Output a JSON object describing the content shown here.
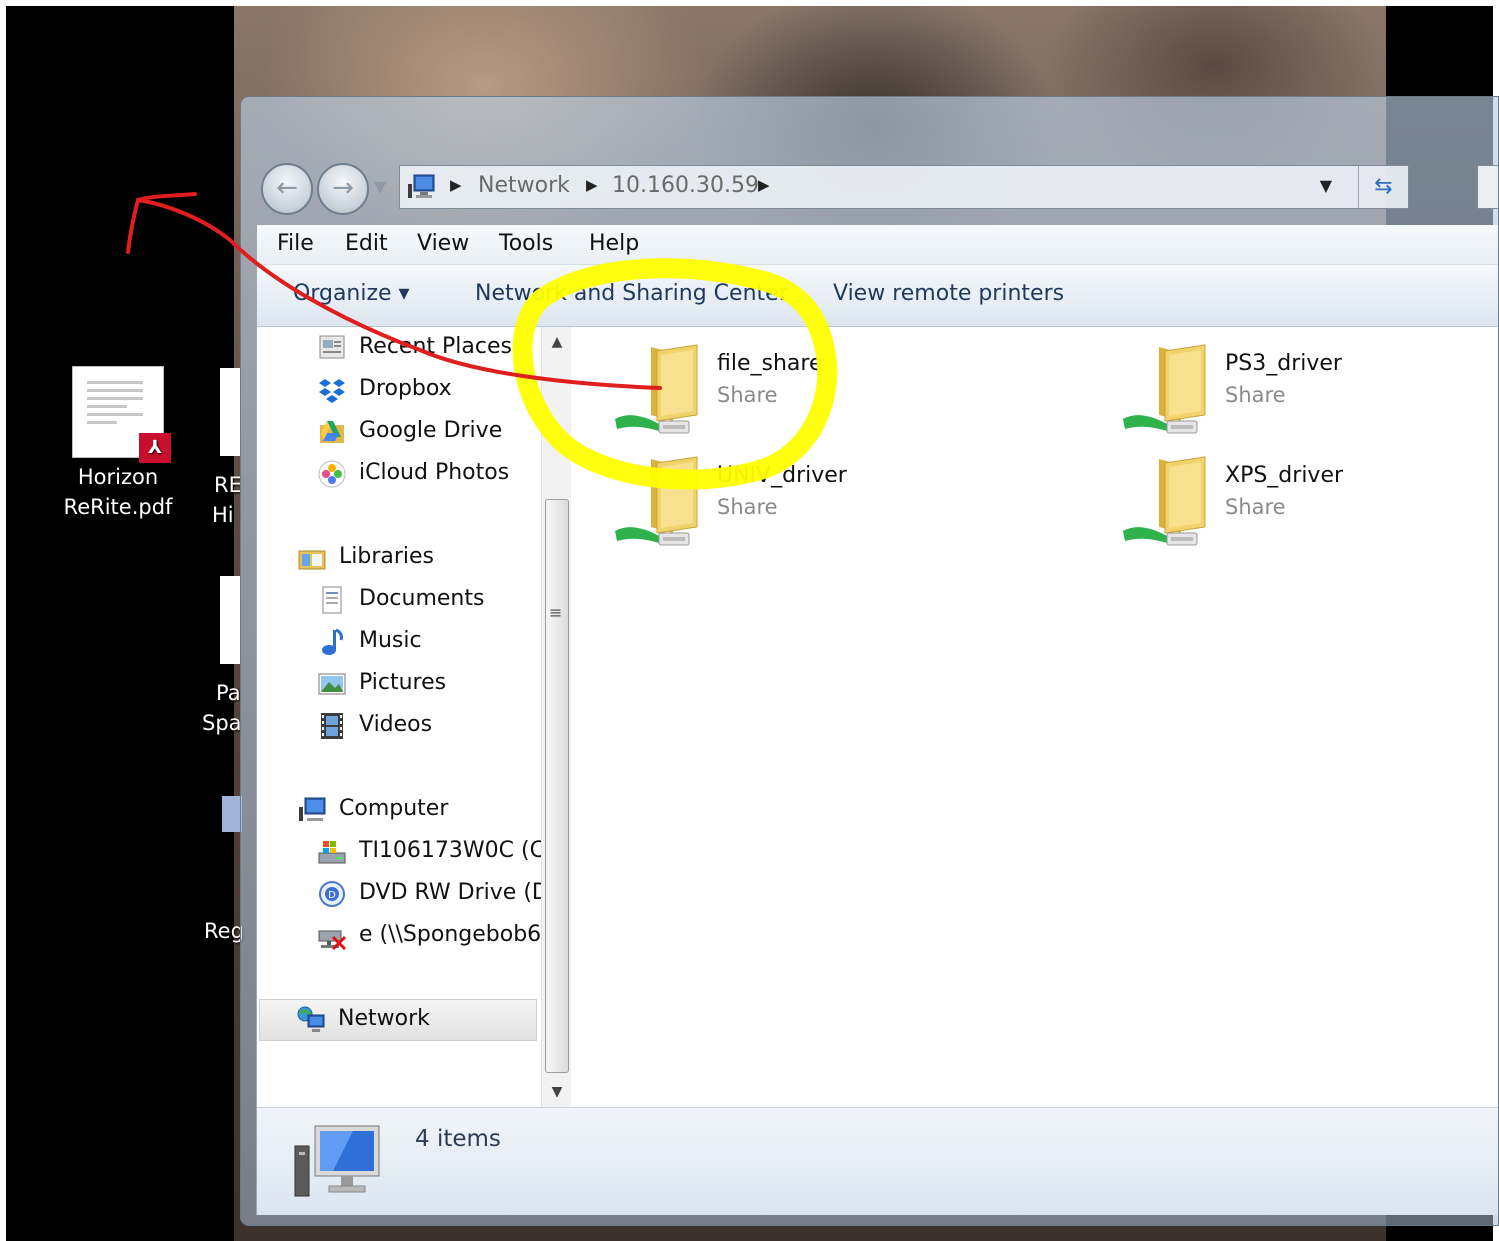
{
  "desktop": {
    "icons": [
      {
        "label_line1": "Horizon",
        "label_line2": "ReRite.pdf",
        "badge": "⅄"
      }
    ],
    "partial_labels": [
      "RE",
      "Hi",
      "Pa",
      "Spa",
      "Reg"
    ]
  },
  "window": {
    "breadcrumbs": [
      "Network",
      "10.160.30.59"
    ],
    "menu": [
      "File",
      "Edit",
      "View",
      "Tools",
      "Help"
    ],
    "commands": {
      "organize": "Organize ▾",
      "network_sharing": "Network and Sharing Center",
      "remote_printers": "View remote printers"
    },
    "nav_pane": {
      "favorites": [
        "Recent Places",
        "Dropbox",
        "Google Drive",
        "iCloud Photos"
      ],
      "libraries_header": "Libraries",
      "libraries": [
        "Documents",
        "Music",
        "Pictures",
        "Videos"
      ],
      "computer_header": "Computer",
      "drives": [
        "TI106173W0C (C:",
        "DVD RW Drive (D",
        "e (\\\\Spongebob6"
      ],
      "network": "Network"
    },
    "shares": [
      {
        "name": "file_share",
        "type": "Share"
      },
      {
        "name": "PS3_driver",
        "type": "Share"
      },
      {
        "name": "UNIV_driver",
        "type": "Share"
      },
      {
        "name": "XPS_driver",
        "type": "Share"
      }
    ],
    "status": "4 items"
  },
  "colors": {
    "annotation_red": "#e01e1e",
    "annotation_yellow": "#ffff00",
    "link_blue": "#1e395b"
  }
}
